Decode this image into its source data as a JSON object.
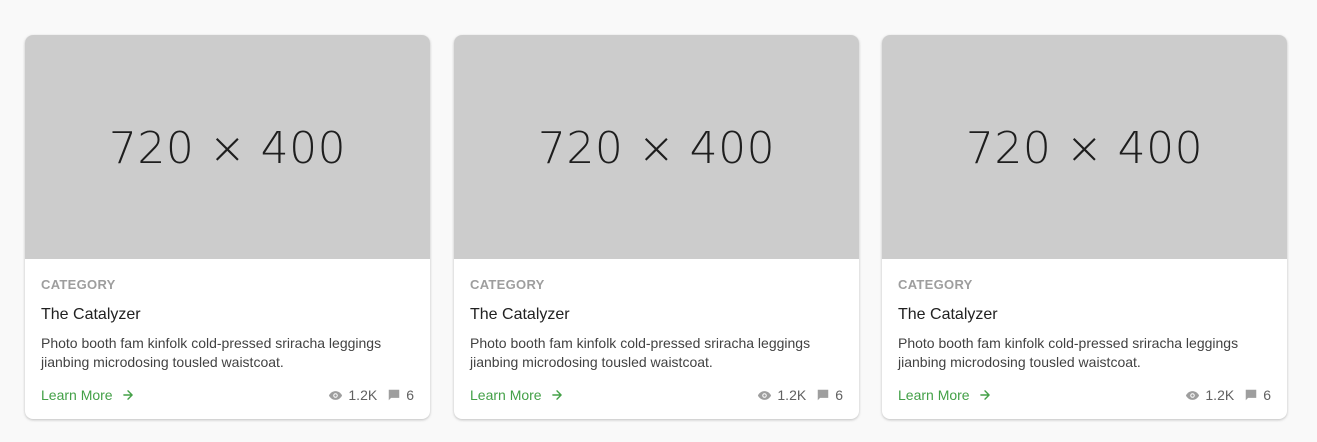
{
  "colors": {
    "page_background": "#f9f9f9",
    "card_background": "#ffffff",
    "media_background": "#cccccc",
    "accent_green": "#43a047",
    "muted_gray": "#9e9e9e"
  },
  "cards": [
    {
      "media_label": "720 × 400",
      "category": "CATEGORY",
      "title": "The Catalyzer",
      "description": "Photo booth fam kinfolk cold-pressed sriracha leggings jianbing microdosing tousled waistcoat.",
      "link_label": "Learn More",
      "link_icon": "arrow-right-icon",
      "views": "1.2K",
      "views_icon": "eye-icon",
      "comments": "6",
      "comments_icon": "comment-icon"
    },
    {
      "media_label": "720 × 400",
      "category": "CATEGORY",
      "title": "The Catalyzer",
      "description": "Photo booth fam kinfolk cold-pressed sriracha leggings jianbing microdosing tousled waistcoat.",
      "link_label": "Learn More",
      "link_icon": "arrow-right-icon",
      "views": "1.2K",
      "views_icon": "eye-icon",
      "comments": "6",
      "comments_icon": "comment-icon"
    },
    {
      "media_label": "720 × 400",
      "category": "CATEGORY",
      "title": "The Catalyzer",
      "description": "Photo booth fam kinfolk cold-pressed sriracha leggings jianbing microdosing tousled waistcoat.",
      "link_label": "Learn More",
      "link_icon": "arrow-right-icon",
      "views": "1.2K",
      "views_icon": "eye-icon",
      "comments": "6",
      "comments_icon": "comment-icon"
    }
  ]
}
